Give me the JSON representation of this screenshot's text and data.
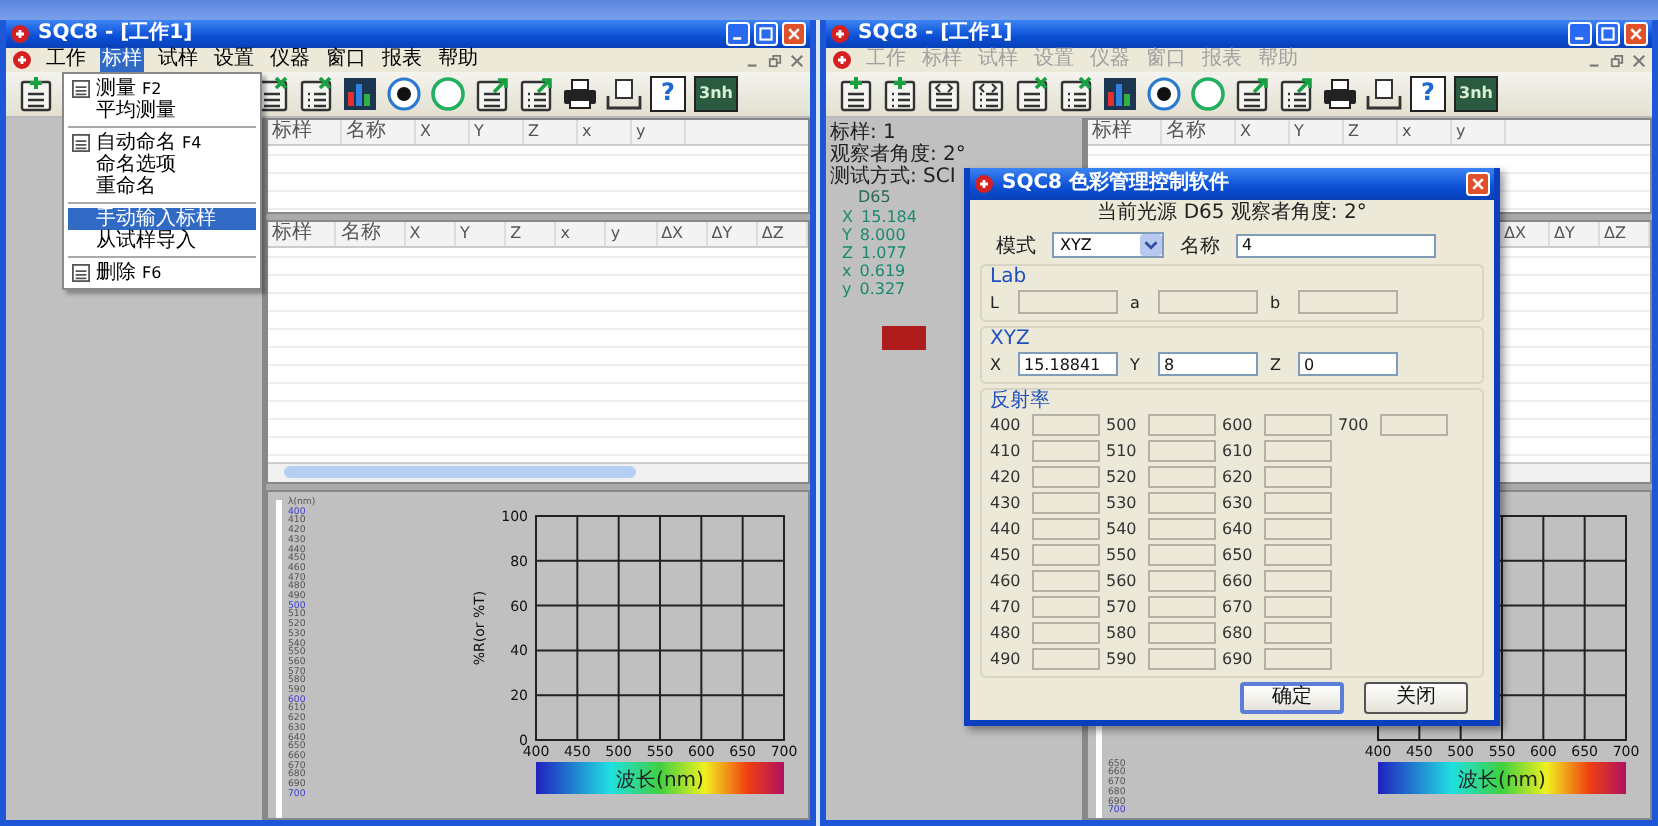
{
  "windows": [
    {
      "title": "SQC8 - [工作1]",
      "menu_disabled": false,
      "menu": [
        {
          "label": "工作",
          "selected": false
        },
        {
          "label": "标样",
          "selected": true
        },
        {
          "label": "试样",
          "selected": false
        },
        {
          "label": "设置",
          "selected": false
        },
        {
          "label": "仪器",
          "selected": false
        },
        {
          "label": "窗口",
          "selected": false
        },
        {
          "label": "报表",
          "selected": false
        },
        {
          "label": "帮助",
          "selected": false
        }
      ],
      "toolbar": [
        {
          "kind": "doc-add"
        },
        {
          "kind": "doc-delete"
        },
        {
          "kind": "list-delete"
        },
        {
          "kind": "chart"
        },
        {
          "kind": "record"
        },
        {
          "kind": "circle"
        },
        {
          "kind": "doc-export"
        },
        {
          "kind": "list-export"
        },
        {
          "kind": "printer"
        },
        {
          "kind": "tray"
        },
        {
          "kind": "help",
          "text": "?"
        },
        {
          "kind": "logo",
          "text": "3nh"
        }
      ],
      "dropdown": [
        {
          "kind": "item",
          "label": "测量",
          "shortcut": "F2",
          "icon": true,
          "selected": false
        },
        {
          "kind": "item",
          "label": "平均测量",
          "icon": false,
          "selected": false
        },
        {
          "kind": "separator"
        },
        {
          "kind": "item",
          "label": "自动命名",
          "shortcut": "F4",
          "icon": true,
          "selected": false
        },
        {
          "kind": "item",
          "label": "命名选项",
          "icon": false,
          "selected": false
        },
        {
          "kind": "item",
          "label": "重命名",
          "icon": false,
          "selected": false
        },
        {
          "kind": "separator"
        },
        {
          "kind": "item",
          "label": "手动输入标样",
          "icon": false,
          "selected": true
        },
        {
          "kind": "item",
          "label": "从试样导入",
          "icon": false,
          "selected": false
        },
        {
          "kind": "separator"
        },
        {
          "kind": "item",
          "label": "删除",
          "shortcut": "F6",
          "icon": true,
          "selected": false
        }
      ],
      "table1": {
        "columns": [
          "标样",
          "名称",
          "X",
          "Y",
          "Z",
          "x",
          "y"
        ]
      },
      "table2": {
        "columns": [
          "标样",
          "名称",
          "X",
          "Y",
          "Z",
          "x",
          "y",
          "ΔX",
          "ΔY",
          "ΔZ"
        ]
      },
      "wavelength_list": {
        "header": "λ(nm)",
        "items": [
          {
            "text": "400",
            "marked": true
          },
          {
            "text": "410",
            "marked": false
          },
          {
            "text": "420",
            "marked": false
          },
          {
            "text": "430",
            "marked": false
          },
          {
            "text": "440",
            "marked": false
          },
          {
            "text": "450",
            "marked": false
          },
          {
            "text": "460",
            "marked": false
          },
          {
            "text": "470",
            "marked": false
          },
          {
            "text": "480",
            "marked": false
          },
          {
            "text": "490",
            "marked": false
          },
          {
            "text": "500",
            "marked": true
          },
          {
            "text": "510",
            "marked": false
          },
          {
            "text": "520",
            "marked": false
          },
          {
            "text": "530",
            "marked": false
          },
          {
            "text": "540",
            "marked": false
          },
          {
            "text": "550",
            "marked": false
          },
          {
            "text": "560",
            "marked": false
          },
          {
            "text": "570",
            "marked": false
          },
          {
            "text": "580",
            "marked": false
          },
          {
            "text": "590",
            "marked": false
          },
          {
            "text": "600",
            "marked": true
          },
          {
            "text": "610",
            "marked": false
          },
          {
            "text": "620",
            "marked": false
          },
          {
            "text": "630",
            "marked": false
          },
          {
            "text": "640",
            "marked": false
          },
          {
            "text": "650",
            "marked": false
          },
          {
            "text": "660",
            "marked": false
          },
          {
            "text": "670",
            "marked": false
          },
          {
            "text": "680",
            "marked": false
          },
          {
            "text": "690",
            "marked": false
          },
          {
            "text": "700",
            "marked": true
          }
        ]
      },
      "chart_data": {
        "type": "line",
        "grid": true,
        "xlabel": "波长(nm)",
        "ylabel": "%R(or %T)",
        "xlim": [
          400,
          700
        ],
        "ylim": [
          0,
          100
        ],
        "xticks": [
          400,
          450,
          500,
          550,
          600,
          650,
          700
        ],
        "yticks": [
          0,
          20,
          40,
          60,
          80,
          100
        ]
      }
    },
    {
      "title": "SQC8 - [工作1]",
      "menu_disabled": true,
      "menu": [
        {
          "label": "工作",
          "selected": false
        },
        {
          "label": "标样",
          "selected": false
        },
        {
          "label": "试样",
          "selected": false
        },
        {
          "label": "设置",
          "selected": false
        },
        {
          "label": "仪器",
          "selected": false
        },
        {
          "label": "窗口",
          "selected": false
        },
        {
          "label": "报表",
          "selected": false
        },
        {
          "label": "帮助",
          "selected": false
        }
      ],
      "toolbar": [
        {
          "kind": "doc-add"
        },
        {
          "kind": "list-add"
        },
        {
          "kind": "doc-code"
        },
        {
          "kind": "list-code"
        },
        {
          "kind": "doc-delete"
        },
        {
          "kind": "list-delete"
        },
        {
          "kind": "chart"
        },
        {
          "kind": "record"
        },
        {
          "kind": "circle"
        },
        {
          "kind": "doc-export"
        },
        {
          "kind": "list-export"
        },
        {
          "kind": "printer"
        },
        {
          "kind": "tray"
        },
        {
          "kind": "help",
          "text": "?"
        },
        {
          "kind": "logo",
          "text": "3nh"
        }
      ],
      "info_panel": {
        "lines": [
          "标样: 1",
          "观察者角度: 2° 测试方式: SCI"
        ],
        "illuminant": "D65",
        "values": [
          {
            "name": "X",
            "value": "15.184"
          },
          {
            "name": "Y",
            "value": "8.000"
          },
          {
            "name": "Z",
            "value": "1.077"
          },
          {
            "name": "x",
            "value": "0.619"
          },
          {
            "name": "y",
            "value": "0.327"
          }
        ],
        "color": "#b01c1c"
      },
      "table1": {
        "columns": [
          "标样",
          "名称",
          "X",
          "Y",
          "Z",
          "x",
          "y"
        ]
      },
      "table2": {
        "columns": [
          "ΔX",
          "ΔY",
          "ΔZ"
        ]
      },
      "wavelength_list": {
        "items": [
          {
            "text": "650",
            "marked": false
          },
          {
            "text": "660",
            "marked": false
          },
          {
            "text": "670",
            "marked": false
          },
          {
            "text": "680",
            "marked": false
          },
          {
            "text": "690",
            "marked": false
          },
          {
            "text": "700",
            "marked": true
          }
        ]
      },
      "chart_data": {
        "type": "line",
        "grid": true,
        "xlabel": "波长(nm)",
        "xlim": [
          400,
          700
        ],
        "ylim": [
          0,
          100
        ],
        "xticks": [
          400,
          450,
          500,
          550,
          600,
          650,
          700
        ]
      },
      "dialog": {
        "title": "SQC8 色彩管理控制软件",
        "subtitle": "当前光源 D65 观察者角度: 2°",
        "mode": {
          "label": "模式",
          "value": "XYZ"
        },
        "name": {
          "label": "名称",
          "value": "4"
        },
        "lab": {
          "legend": "Lab",
          "fields": [
            {
              "label": "L",
              "disabled": true
            },
            {
              "label": "a",
              "disabled": true
            },
            {
              "label": "b",
              "disabled": true
            }
          ]
        },
        "xyz": {
          "legend": "XYZ",
          "fields": [
            {
              "label": "X",
              "value": "15.18841",
              "disabled": false
            },
            {
              "label": "Y",
              "value": "8",
              "disabled": false
            },
            {
              "label": "Z",
              "value": "0",
              "disabled": false
            }
          ]
        },
        "reflectance": {
          "legend": "反射率",
          "fields": [
            {
              "label": "400",
              "disabled": true
            },
            {
              "label": "410",
              "disabled": true
            },
            {
              "label": "420",
              "disabled": true
            },
            {
              "label": "430",
              "disabled": true
            },
            {
              "label": "440",
              "disabled": true
            },
            {
              "label": "450",
              "disabled": true
            },
            {
              "label": "460",
              "disabled": true
            },
            {
              "label": "470",
              "disabled": true
            },
            {
              "label": "480",
              "disabled": true
            },
            {
              "label": "490",
              "disabled": true
            },
            {
              "label": "500",
              "disabled": true
            },
            {
              "label": "510",
              "disabled": true
            },
            {
              "label": "520",
              "disabled": true
            },
            {
              "label": "530",
              "disabled": true
            },
            {
              "label": "540",
              "disabled": true
            },
            {
              "label": "550",
              "disabled": true
            },
            {
              "label": "560",
              "disabled": true
            },
            {
              "label": "570",
              "disabled": true
            },
            {
              "label": "580",
              "disabled": true
            },
            {
              "label": "590",
              "disabled": true
            },
            {
              "label": "600",
              "disabled": true
            },
            {
              "label": "610",
              "disabled": true
            },
            {
              "label": "620",
              "disabled": true
            },
            {
              "label": "630",
              "disabled": true
            },
            {
              "label": "640",
              "disabled": true
            },
            {
              "label": "650",
              "disabled": true
            },
            {
              "label": "660",
              "disabled": true
            },
            {
              "label": "670",
              "disabled": true
            },
            {
              "label": "680",
              "disabled": true
            },
            {
              "label": "690",
              "disabled": true
            },
            {
              "label": "700",
              "disabled": true
            }
          ]
        },
        "buttons": [
          {
            "label": "确定",
            "default": true
          },
          {
            "label": "关闭",
            "default": false
          }
        ]
      }
    }
  ]
}
